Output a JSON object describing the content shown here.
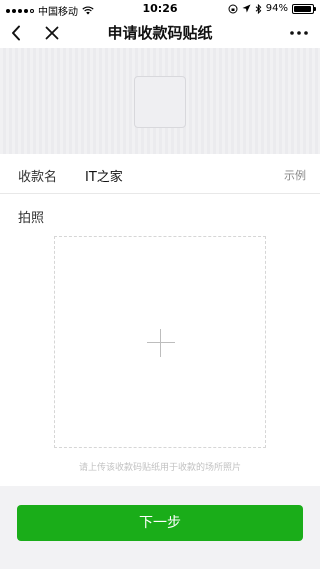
{
  "status_bar": {
    "carrier": "中国移动",
    "time": "10:26",
    "battery_percent": "94%",
    "battery_level": 0.94
  },
  "nav": {
    "title": "申请收款码贴纸",
    "back_icon": "chevron-left-icon",
    "close_icon": "close-icon",
    "more_icon": "more-dots-icon"
  },
  "form": {
    "name_label": "收款名",
    "name_value": "IT之家",
    "example_link": "示例",
    "photo_label": "拍照",
    "upload_hint": "请上传该收款码贴纸用于收款的场所照片"
  },
  "footer": {
    "next_label": "下一步"
  },
  "colors": {
    "primary_green": "#1aad19",
    "background_gray": "#f2f2f4"
  }
}
